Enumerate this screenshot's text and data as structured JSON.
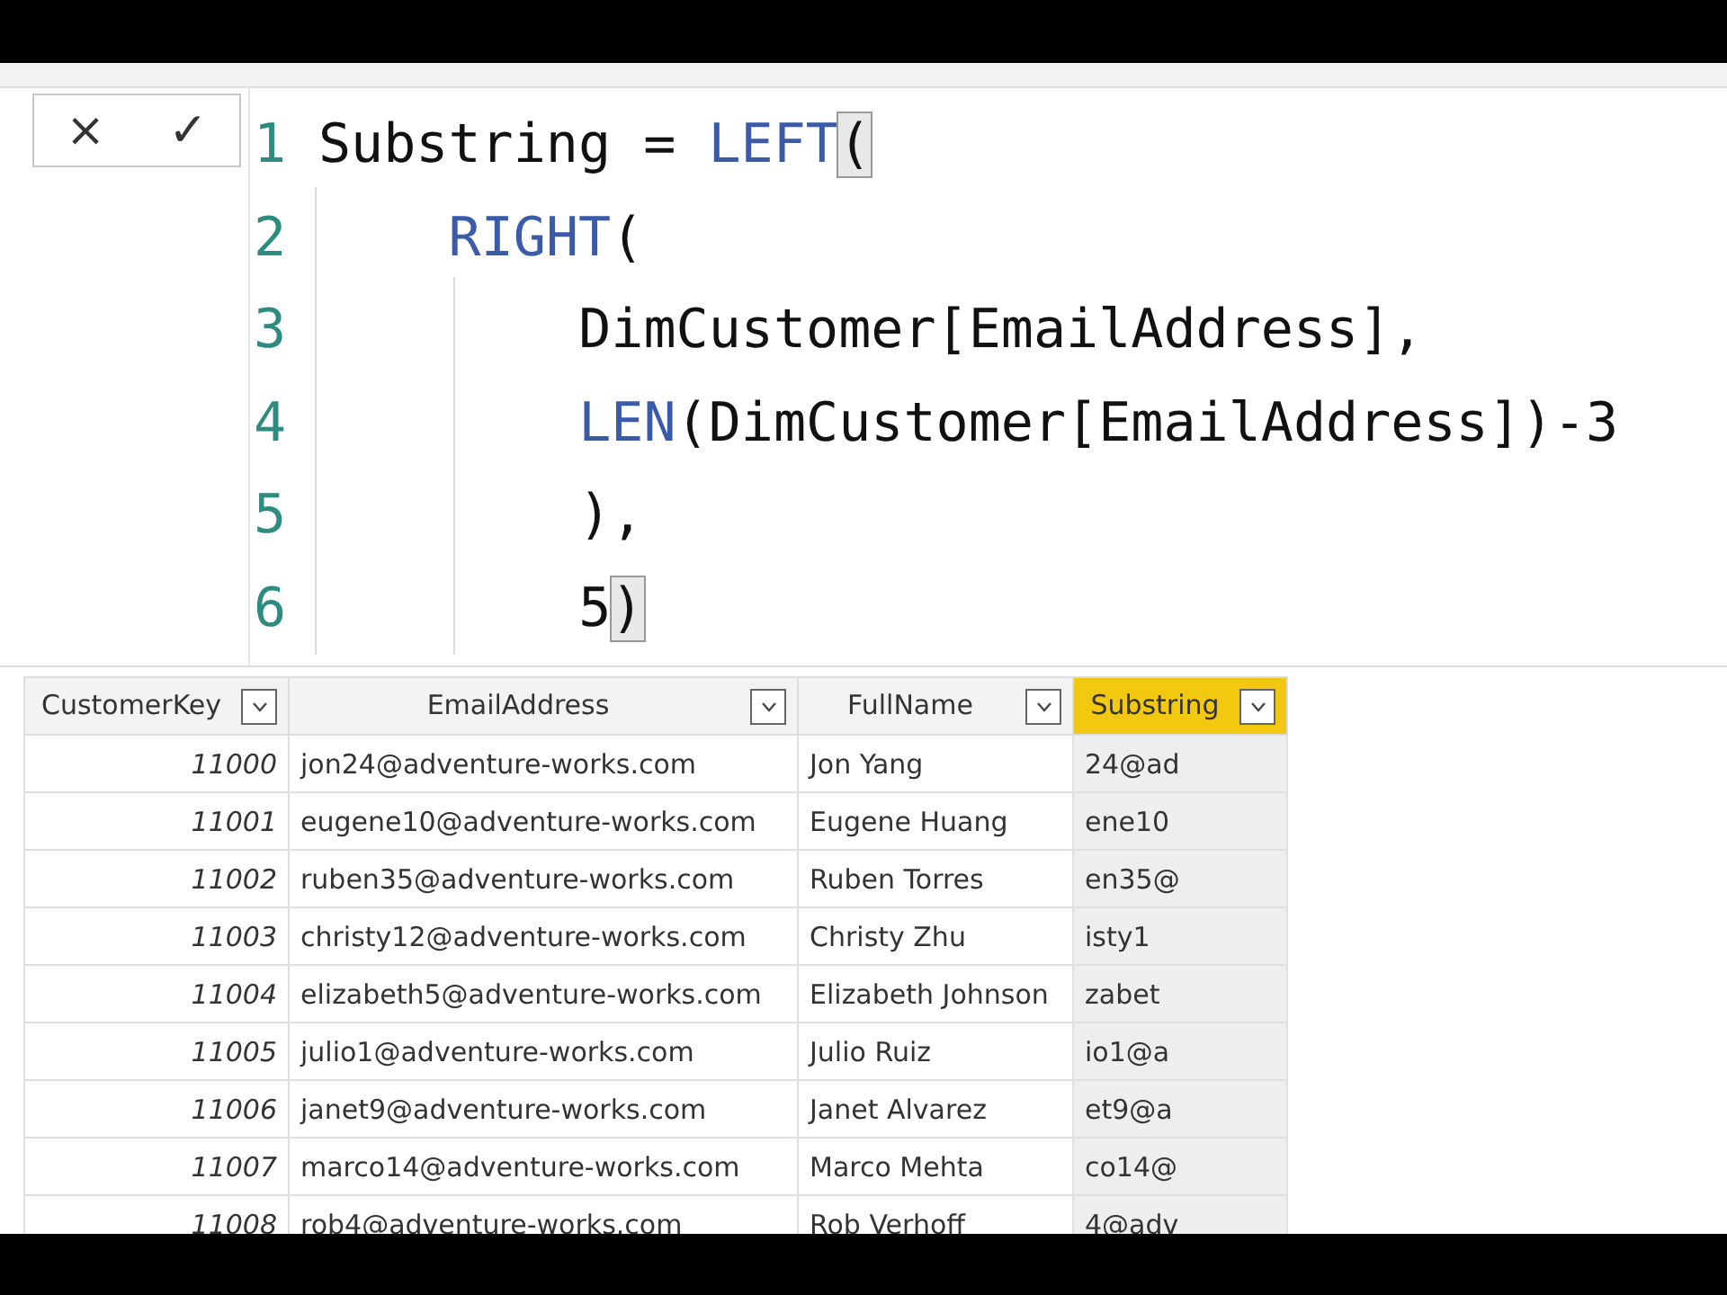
{
  "formula_bar": {
    "buttons": [
      "×",
      "✓"
    ],
    "lines": [
      {
        "number": "1",
        "kind": "top",
        "tokens": [
          {
            "kind": "text",
            "text": "Substring = "
          },
          {
            "kind": "func",
            "text": "LEFT"
          },
          {
            "kind": "match",
            "text": "("
          }
        ]
      },
      {
        "number": "2",
        "kind": "inner",
        "tokens": [
          {
            "kind": "func",
            "text": "RIGHT"
          },
          {
            "kind": "text",
            "text": "("
          }
        ]
      },
      {
        "number": "3",
        "kind": "deep",
        "tokens": [
          {
            "kind": "text",
            "text": "DimCustomer[EmailAddress],"
          }
        ]
      },
      {
        "number": "4",
        "kind": "deep",
        "tokens": [
          {
            "kind": "func",
            "text": "LEN"
          },
          {
            "kind": "text",
            "text": "(DimCustomer[EmailAddress])-3"
          }
        ]
      },
      {
        "number": "5",
        "kind": "deep",
        "tokens": [
          {
            "kind": "text",
            "text": "),"
          }
        ]
      },
      {
        "number": "6",
        "kind": "deep",
        "tokens": [
          {
            "kind": "text",
            "text": "5"
          },
          {
            "kind": "match",
            "text": ")"
          }
        ]
      }
    ]
  },
  "table": {
    "columns": [
      {
        "label": "CustomerKey",
        "selected": false
      },
      {
        "label": "EmailAddress",
        "selected": false
      },
      {
        "label": "FullName",
        "selected": false
      },
      {
        "label": "Substring",
        "selected": true
      }
    ],
    "rows": [
      [
        "11000",
        "jon24@adventure-works.com",
        "Jon Yang",
        "24@ad"
      ],
      [
        "11001",
        "eugene10@adventure-works.com",
        "Eugene Huang",
        "ene10"
      ],
      [
        "11002",
        "ruben35@adventure-works.com",
        "Ruben Torres",
        "en35@"
      ],
      [
        "11003",
        "christy12@adventure-works.com",
        "Christy Zhu",
        "isty1"
      ],
      [
        "11004",
        "elizabeth5@adventure-works.com",
        "Elizabeth Johnson",
        "zabet"
      ],
      [
        "11005",
        "julio1@adventure-works.com",
        "Julio Ruiz",
        "io1@a"
      ],
      [
        "11006",
        "janet9@adventure-works.com",
        "Janet Alvarez",
        "et9@a"
      ],
      [
        "11007",
        "marco14@adventure-works.com",
        "Marco Mehta",
        "co14@"
      ],
      [
        "11008",
        "rob4@adventure-works.com",
        "Rob Verhoff",
        "4@adv"
      ]
    ]
  }
}
